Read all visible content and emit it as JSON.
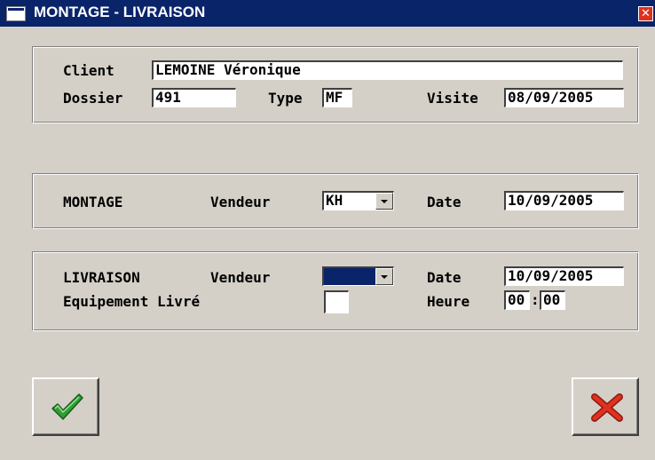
{
  "window": {
    "title": "MONTAGE - LIVRAISON"
  },
  "client_section": {
    "client_label": "Client",
    "client_value": "LEMOINE Véronique",
    "dossier_label": "Dossier",
    "dossier_value": "491",
    "type_label": "Type",
    "type_value": "MF",
    "visite_label": "Visite",
    "visite_value": "08/09/2005"
  },
  "montage_section": {
    "section_label": "MONTAGE",
    "vendeur_label": "Vendeur",
    "vendeur_value": "KH",
    "date_label": "Date",
    "date_value": "10/09/2005"
  },
  "livraison_section": {
    "section_label": "LIVRAISON",
    "vendeur_label": "Vendeur",
    "vendeur_value": "",
    "date_label": "Date",
    "date_value": "10/09/2005",
    "equipement_label": "Equipement Livré",
    "equipement_checked": false,
    "heure_label": "Heure",
    "heure_hours": "00",
    "heure_separator": ":",
    "heure_minutes": "00"
  },
  "buttons": {
    "validate_icon": "checkmark-icon",
    "cancel_icon": "cross-icon"
  },
  "colors": {
    "titlebar": "#0a246a",
    "window_bg": "#d4d0c8",
    "check_green": "#2fa02f",
    "cross_red": "#e0301e"
  }
}
